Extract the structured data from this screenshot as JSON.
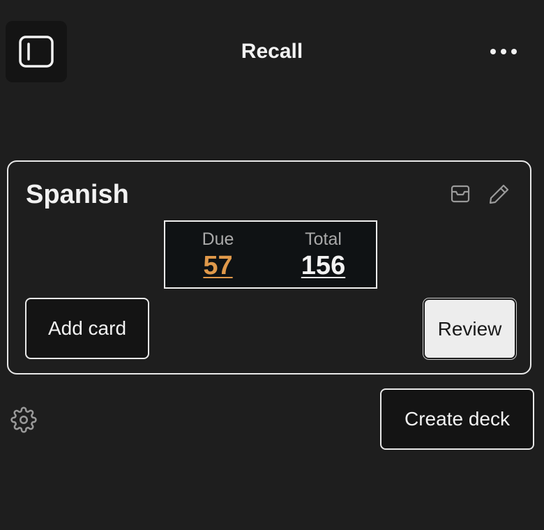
{
  "header": {
    "title": "Recall",
    "sidebar_toggle_icon": "sidebar-toggle-icon",
    "more_icon": "more-horizontal-icon"
  },
  "deck": {
    "name": "Spanish",
    "archive_icon": "archive-icon",
    "edit_icon": "pencil-icon",
    "stats": {
      "due_label": "Due",
      "due_value": "57",
      "total_label": "Total",
      "total_value": "156"
    },
    "add_card_label": "Add card",
    "review_label": "Review"
  },
  "footer": {
    "settings_icon": "gear-icon",
    "create_deck_label": "Create deck"
  },
  "colors": {
    "background": "#1e1e1e",
    "due_accent": "#e0994a",
    "review_button_bg": "#ededed"
  }
}
